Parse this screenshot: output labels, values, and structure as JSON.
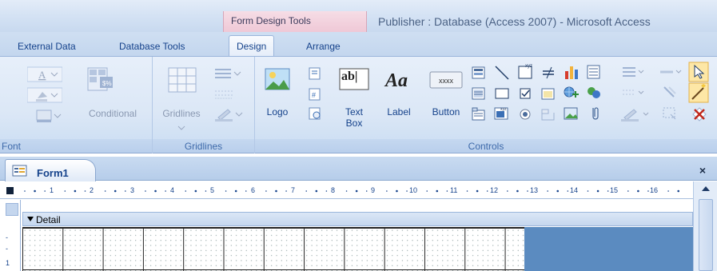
{
  "titlebar": {
    "contextual_tab": "Form Design Tools",
    "app_title": "Publisher : Database (Access 2007) - Microsoft Access"
  },
  "tabs": [
    {
      "label": "External Data"
    },
    {
      "label": "Database Tools"
    },
    {
      "label": "Design",
      "active": true
    },
    {
      "label": "Arrange"
    }
  ],
  "ribbon": {
    "font_group": {
      "label": "Font"
    },
    "conditional": {
      "label": "Conditional"
    },
    "gridlines_group": {
      "label": "Gridlines",
      "button_label": "Gridlines"
    },
    "controls_group": {
      "label": "Controls",
      "logo": "Logo",
      "text_box_line1": "Text",
      "text_box_line2": "Box",
      "label_btn": "Label",
      "button_btn": "Button",
      "button_icon_text": "xxxx",
      "textbox_icon_text": "ab|",
      "label_icon_text": "Aa"
    }
  },
  "document": {
    "tab_title": "Form1",
    "close_glyph": "×",
    "section_label": "Detail",
    "ruler_numbers": [
      "1",
      "2",
      "3",
      "4",
      "5",
      "6",
      "7",
      "8",
      "9",
      "10",
      "11",
      "12",
      "13",
      "14",
      "15",
      "16"
    ],
    "vruler_number": "1"
  },
  "colors": {
    "ribbon_text": "#15428b",
    "contextual_pink": "#f6dde6",
    "backfill_blue": "#5b8bc0"
  }
}
